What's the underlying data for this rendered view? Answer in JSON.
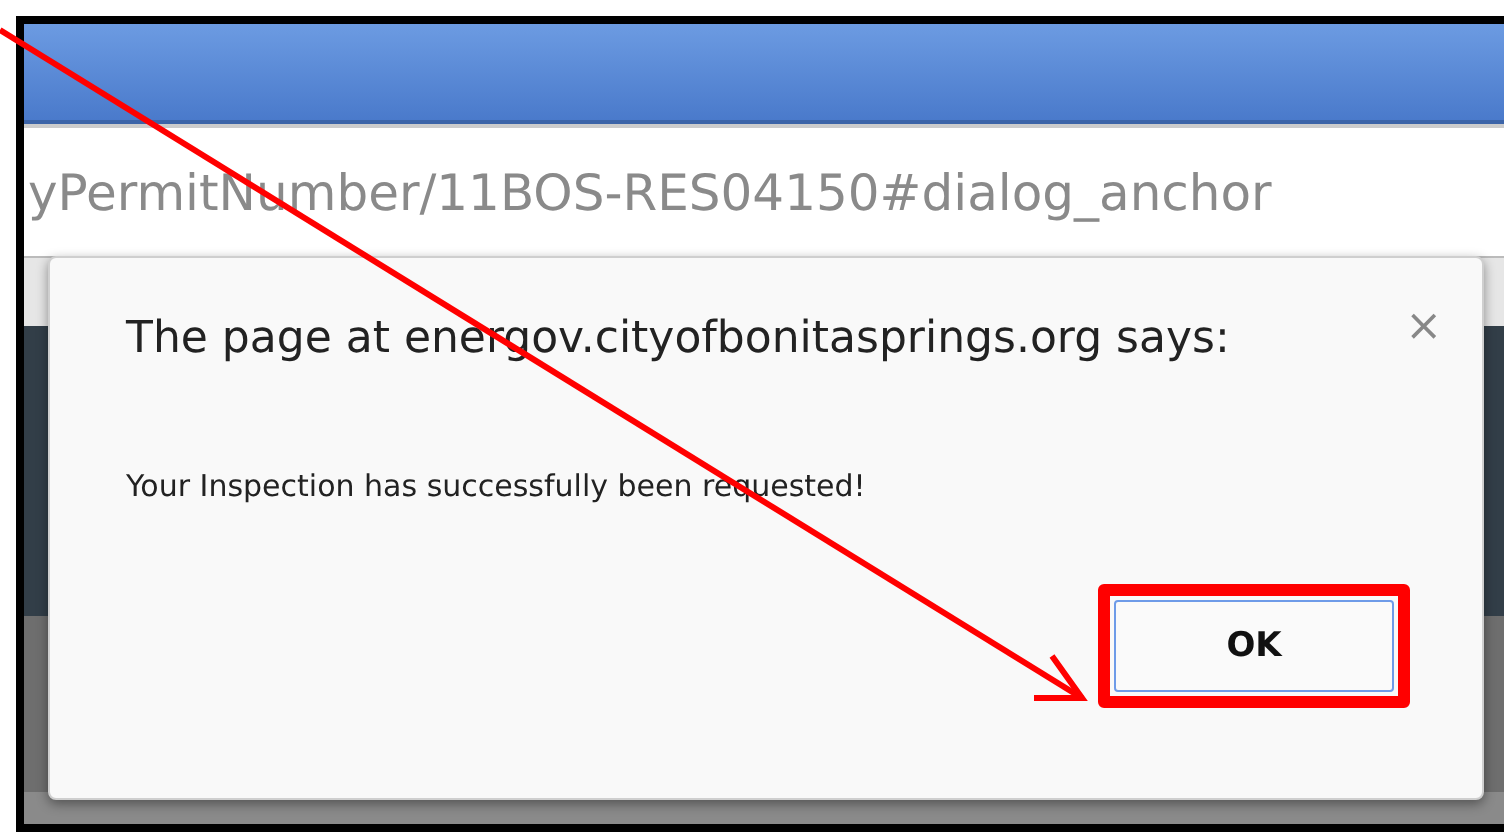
{
  "browser": {
    "address": "yPermitNumber/11BOS-RES04150#dialog_anchor"
  },
  "dialog": {
    "title": "The page at energov.cityofbonitasprings.org says:",
    "close": "×",
    "message": "Your Inspection has successfully been requested!",
    "button": "OK",
    "button_highlighted": true
  },
  "arrow_annotation": true
}
